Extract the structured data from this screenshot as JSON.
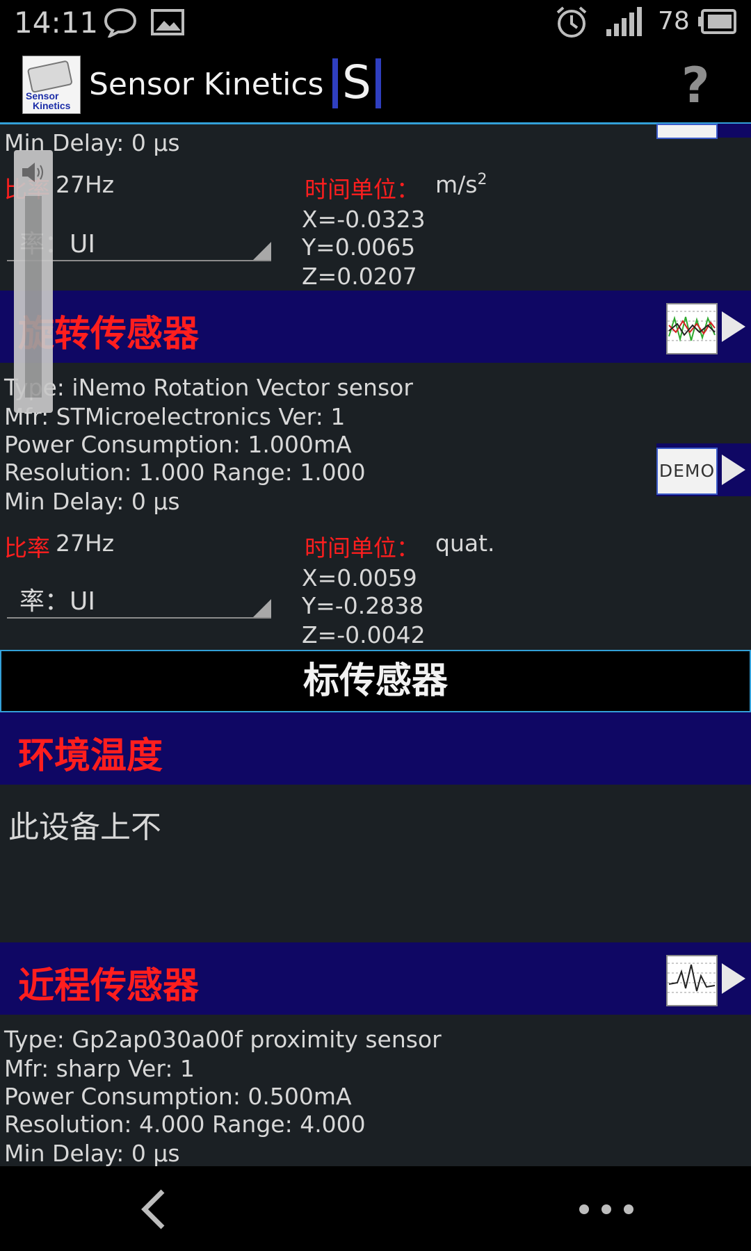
{
  "status_bar": {
    "time": "14:11",
    "battery": "78"
  },
  "app_bar": {
    "title": "Sensor Kinetics",
    "logo_text": [
      "Sensor",
      "Kinetics"
    ],
    "badge": "S",
    "help": "?"
  },
  "accel_tail": {
    "min_delay": "Min Delay: 0 µs",
    "rate_label": "比率",
    "rate_value": "27Hz",
    "unit_label": "时间单位：",
    "unit_value": "m/s",
    "unit_sup": "2",
    "mode": "率：UI",
    "x": "X=-0.0323",
    "y": "Y=0.0065",
    "z": "Z=0.0207"
  },
  "rotation": {
    "title": "旋转传感器",
    "type": "Type: iNemo Rotation Vector sensor",
    "mfr": "Mfr: STMicroelectronics  Ver: 1",
    "power": "Power Consumption: 1.000mA",
    "resolution": "Resolution: 1.000 Range: 1.000",
    "min_delay": "Min Delay: 0 µs",
    "demo": "DEMO",
    "rate_label": "比率",
    "rate_value": "27Hz",
    "unit_label": "时间单位：",
    "unit_value": "quat.",
    "mode": "率：UI",
    "x": "X=0.0059",
    "y": "Y=-0.2838",
    "z": "Z=-0.0042"
  },
  "section": {
    "title": "标传感器"
  },
  "ambient": {
    "title": "环境温度",
    "message": "此设备上不"
  },
  "proximity": {
    "title": "近程传感器",
    "type": "Type: Gp2ap030a00f proximity sensor",
    "mfr": "Mfr: sharp  Ver: 1",
    "power": "Power Consumption: 0.500mA",
    "resolution": "Resolution: 4.000 Range: 4.000",
    "min_delay": "Min Delay: 0 µs"
  },
  "nav": {
    "back": "back",
    "more": "more"
  },
  "colors": {
    "header_bg": "#0f0764",
    "accent": "#33a0d8",
    "label_red": "#ff1e1e",
    "body_bg": "#1b2024"
  }
}
